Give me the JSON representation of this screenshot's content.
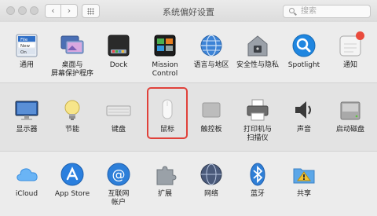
{
  "window": {
    "title": "系统偏好设置",
    "search_placeholder": "搜索",
    "back_glyph": "‹",
    "forward_glyph": "›"
  },
  "rows": [
    [
      {
        "label": "通用",
        "icon": "general-icon"
      },
      {
        "label": "桌面与\n屏幕保护程序",
        "icon": "desktop-screensaver-icon"
      },
      {
        "label": "Dock",
        "icon": "dock-icon"
      },
      {
        "label": "Mission\nControl",
        "icon": "mission-control-icon"
      },
      {
        "label": "语言与地区",
        "icon": "language-region-icon"
      },
      {
        "label": "安全性与隐私",
        "icon": "security-privacy-icon"
      },
      {
        "label": "Spotlight",
        "icon": "spotlight-icon"
      },
      {
        "label": "通知",
        "icon": "notifications-icon"
      }
    ],
    [
      {
        "label": "显示器",
        "icon": "displays-icon"
      },
      {
        "label": "节能",
        "icon": "energy-saver-icon"
      },
      {
        "label": "键盘",
        "icon": "keyboard-icon"
      },
      {
        "label": "鼠标",
        "icon": "mouse-icon"
      },
      {
        "label": "触控板",
        "icon": "trackpad-icon"
      },
      {
        "label": "打印机与\n扫描仪",
        "icon": "printers-scanners-icon"
      },
      {
        "label": "声音",
        "icon": "sound-icon"
      },
      {
        "label": "启动磁盘",
        "icon": "startup-disk-icon"
      }
    ],
    [
      {
        "label": "iCloud",
        "icon": "icloud-icon"
      },
      {
        "label": "App Store",
        "icon": "app-store-icon"
      },
      {
        "label": "互联网\n帐户",
        "icon": "internet-accounts-icon"
      },
      {
        "label": "扩展",
        "icon": "extensions-icon"
      },
      {
        "label": "网络",
        "icon": "network-icon"
      },
      {
        "label": "蓝牙",
        "icon": "bluetooth-icon"
      },
      {
        "label": "共享",
        "icon": "sharing-icon"
      }
    ]
  ],
  "general_icon_text": [
    "File",
    "New",
    "On"
  ],
  "colors": {
    "highlight": "#e0413a",
    "notification_badge": "#e94a3c"
  }
}
